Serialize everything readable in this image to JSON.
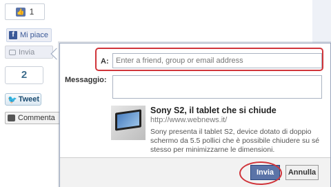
{
  "social": {
    "like_count": "1",
    "like_button": "Mi piace",
    "send_button": "Invia",
    "tweet_count": "2",
    "tweet_button": "Tweet",
    "comment_button": "Commenta"
  },
  "dialog": {
    "to_label": "A:",
    "to_placeholder": "Enter a friend, group or email address",
    "message_label": "Messaggio:",
    "preview": {
      "title": "Sony S2, il tablet che si chiude",
      "url": "http://www.webnews.it/",
      "description": "Sony presenta il tablet S2, device dotato di doppio schermo da 5.5 pollici che è possibile chiudere su sé stesso per minimizzarne le dimensioni."
    },
    "send_button": "Invia",
    "cancel_button": "Annulla"
  },
  "colors": {
    "facebook_blue": "#3b5998",
    "highlight_red": "#d0343a"
  }
}
